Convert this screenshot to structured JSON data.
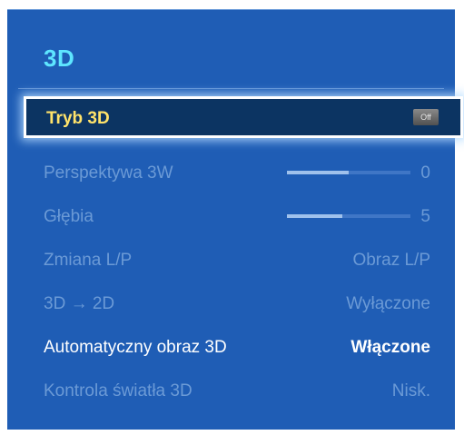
{
  "menu": {
    "title": "3D",
    "items": [
      {
        "label": "Tryb 3D",
        "value": "Off",
        "state": "selected"
      },
      {
        "label": "Perspektywa 3W",
        "value": "0",
        "state": "disabled",
        "slider_level": 0.5
      },
      {
        "label": "Głębia",
        "value": "5",
        "state": "disabled",
        "slider_level": 0.45
      },
      {
        "label": "Zmiana L/P",
        "value": "Obraz L/P",
        "state": "disabled"
      },
      {
        "label": "3D → 2D",
        "value": "Wyłączone",
        "state": "disabled"
      },
      {
        "label": "Automatyczny obraz 3D",
        "value": "Włączone",
        "state": "enabled"
      },
      {
        "label": "Kontrola światła 3D",
        "value": "Nisk.",
        "state": "disabled"
      }
    ]
  },
  "colors": {
    "panel_background": "#1f5db5",
    "title": "#5ee6ff",
    "selected_label": "#ffe36a",
    "selected_background": "#0c3462",
    "disabled_text": "#6b9ad6",
    "enabled_text": "#ffffff"
  }
}
